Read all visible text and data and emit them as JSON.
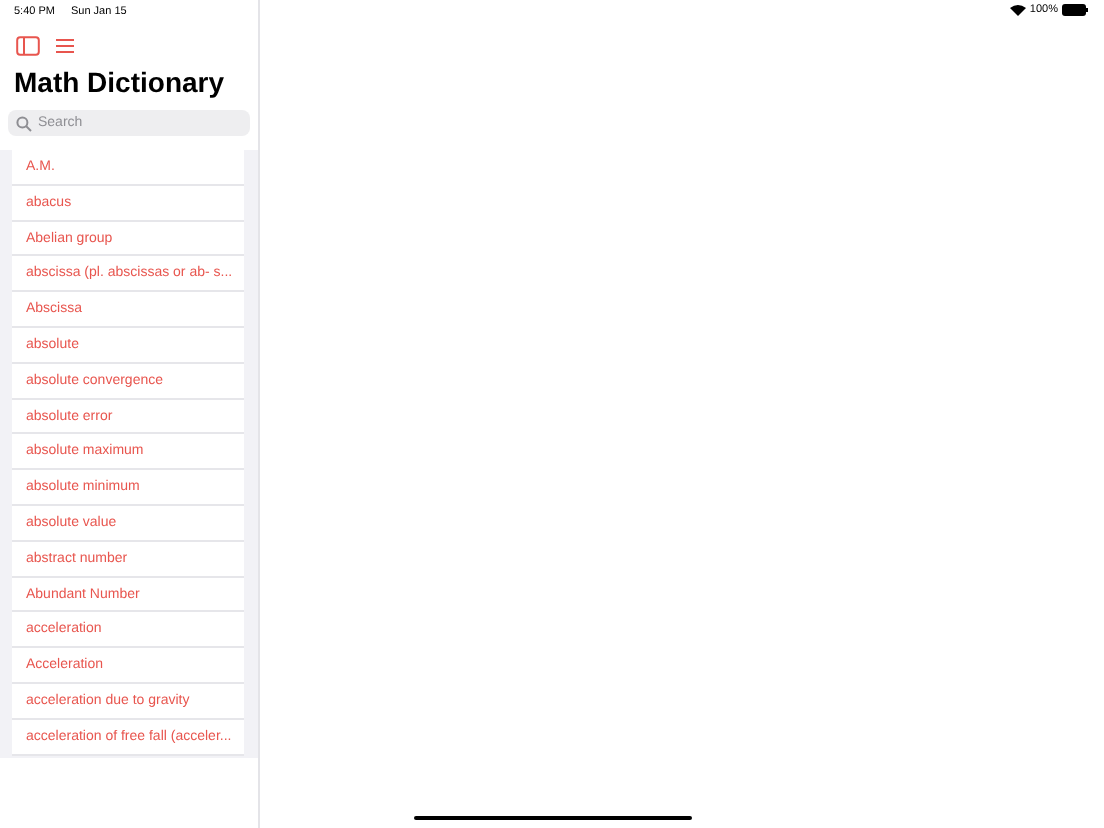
{
  "status_bar": {
    "time": "5:40 PM",
    "date": "Sun Jan 15",
    "battery": "100%"
  },
  "sidebar": {
    "title": "Math Dictionary",
    "search": {
      "placeholder": "Search"
    },
    "items": [
      {
        "label": "A.M."
      },
      {
        "label": "abacus"
      },
      {
        "label": "Abelian group"
      },
      {
        "label": "abscissa (pl. abscissas or ab- s..."
      },
      {
        "label": "Abscissa"
      },
      {
        "label": "absolute"
      },
      {
        "label": "absolute convergence"
      },
      {
        "label": "absolute error"
      },
      {
        "label": "absolute maximum"
      },
      {
        "label": "absolute minimum"
      },
      {
        "label": "absolute value"
      },
      {
        "label": "abstract number"
      },
      {
        "label": "Abundant Number"
      },
      {
        "label": "acceleration"
      },
      {
        "label": "Acceleration"
      },
      {
        "label": "acceleration due to gravity"
      },
      {
        "label": "acceleration of free fall (acceler..."
      }
    ]
  }
}
